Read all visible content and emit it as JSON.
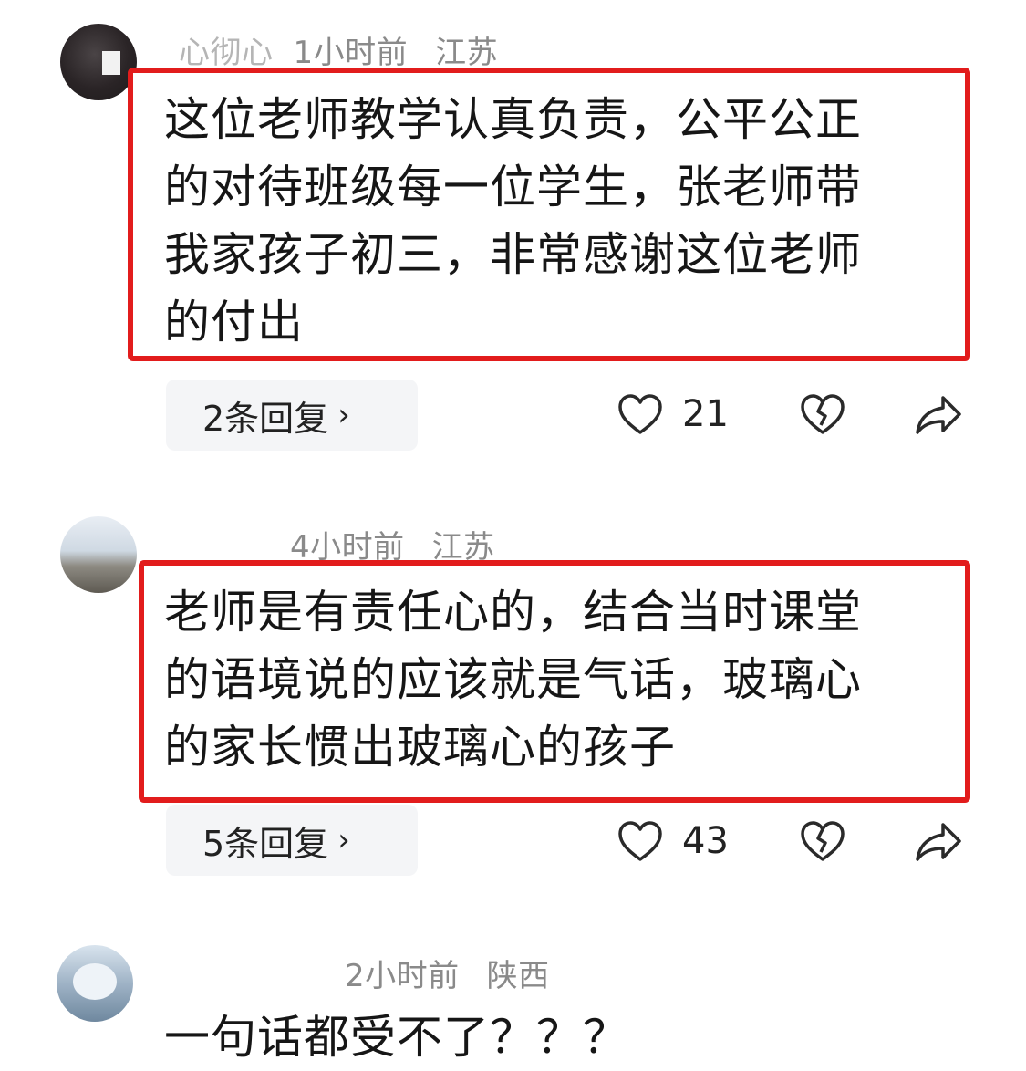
{
  "comments": [
    {
      "nickname": "心彻心",
      "time": "1小时前",
      "location": "江苏",
      "lines": [
        "这位老师教学认真负责，公平公正",
        "的对待班级每一位学生，张老师带",
        "我家孩子初三，非常感谢这位老师",
        "的付出"
      ],
      "replies_label": "2条回复",
      "likes": "21"
    },
    {
      "nickname": "",
      "time": "4小时前",
      "location": "江苏",
      "lines": [
        "老师是有责任心的，结合当时课堂",
        "的语境说的应该就是气话，玻璃心",
        "的家长惯出玻璃心的孩子"
      ],
      "replies_label": "5条回复",
      "likes": "43"
    },
    {
      "nickname": "",
      "time": "2小时前",
      "location": "陕西",
      "lines": [
        "一句话都受不了？？？"
      ]
    }
  ],
  "icons": {
    "like": "heart-icon",
    "dislike": "broken-heart-icon",
    "share": "share-arrow-icon",
    "more_replies": "chevron-right-icon"
  },
  "colors": {
    "highlight_box": "#e21c1c",
    "meta_text": "#8a8a8a"
  }
}
